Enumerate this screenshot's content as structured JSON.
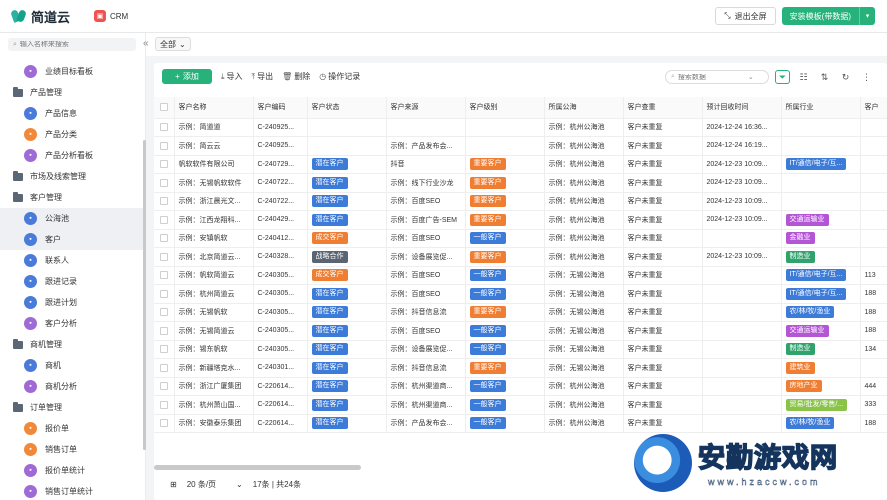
{
  "topbar": {
    "logo_text": "简道云",
    "app_icon_glyph": "▣",
    "app_name": "CRM",
    "exit_fullscreen": "退出全屏",
    "install_template": "安装模板(带数据)"
  },
  "sidebar": {
    "search_placeholder": "输入名称来搜索",
    "items": [
      {
        "label": "业绩目标看板",
        "kind": "child",
        "icon": "c-purple",
        "active": false
      },
      {
        "label": "产品管理",
        "kind": "group",
        "active": false
      },
      {
        "label": "产品信息",
        "kind": "child",
        "icon": "c-blue",
        "active": false
      },
      {
        "label": "产品分类",
        "kind": "child",
        "icon": "c-orange",
        "active": false
      },
      {
        "label": "产品分析看板",
        "kind": "child",
        "icon": "c-purple",
        "active": false
      },
      {
        "label": "市场及线索管理",
        "kind": "group",
        "active": false
      },
      {
        "label": "客户管理",
        "kind": "group",
        "active": false
      },
      {
        "label": "公海池",
        "kind": "child",
        "icon": "c-blue",
        "active": true
      },
      {
        "label": "客户",
        "kind": "child",
        "icon": "c-blue",
        "active": true
      },
      {
        "label": "联系人",
        "kind": "child",
        "icon": "c-blue",
        "active": false
      },
      {
        "label": "跟进记录",
        "kind": "child",
        "icon": "c-blue",
        "active": false
      },
      {
        "label": "跟进计划",
        "kind": "child",
        "icon": "c-blue",
        "active": false
      },
      {
        "label": "客户分析",
        "kind": "child",
        "icon": "c-purple",
        "active": false
      },
      {
        "label": "商机管理",
        "kind": "group",
        "active": false
      },
      {
        "label": "商机",
        "kind": "child",
        "icon": "c-blue",
        "active": false
      },
      {
        "label": "商机分析",
        "kind": "child",
        "icon": "c-purple",
        "active": false
      },
      {
        "label": "订单管理",
        "kind": "group",
        "active": false
      },
      {
        "label": "报价单",
        "kind": "child",
        "icon": "c-orange",
        "active": false
      },
      {
        "label": "销售订单",
        "kind": "child",
        "icon": "c-orange",
        "active": false
      },
      {
        "label": "报价单统计",
        "kind": "child",
        "icon": "c-purple",
        "active": false
      },
      {
        "label": "销售订单统计",
        "kind": "child",
        "icon": "c-purple",
        "active": false
      }
    ]
  },
  "filter": {
    "scope": "全部"
  },
  "toolbar": {
    "add": "添加",
    "import": "导入",
    "export": "导出",
    "delete": "删除",
    "log": "操作记录",
    "search_placeholder": "搜索数据"
  },
  "table": {
    "columns": [
      "客户名称",
      "客户编码",
      "客户状态",
      "客户来源",
      "客户级别",
      "所属公海",
      "客户查重",
      "预计回收时间",
      "所属行业",
      "客户"
    ],
    "rows": [
      {
        "name": "示例：简道道",
        "code": "C-240925...",
        "status": "",
        "source": "",
        "level": "",
        "pool": "示例：杭州公海池",
        "dup": "客户未重复",
        "time": "2024-12-24 16:36...",
        "industry": "",
        "ind_color": "",
        "extra": ""
      },
      {
        "name": "示例：简云云",
        "code": "C-240925...",
        "status": "",
        "source": "示例：产品发布会...",
        "level": "",
        "pool": "示例：杭州公海池",
        "dup": "客户未重复",
        "time": "2024-12-24 16:19...",
        "industry": "",
        "ind_color": "",
        "extra": ""
      },
      {
        "name": "帆软软件有限公司",
        "code": "C-240729...",
        "status": "潜在客户",
        "source": "抖音",
        "level": "重要客户",
        "pool": "示例：杭州公海池",
        "dup": "客户未重复",
        "time": "2024-12-23 10:09...",
        "industry": "IT/通信/电子/互...",
        "ind_color": "#3d7bd8",
        "extra": ""
      },
      {
        "name": "示例：无锡帆软软件",
        "code": "C-240722...",
        "status": "潜在客户",
        "source": "示例：线下行业沙龙",
        "level": "重要客户",
        "pool": "示例：杭州公海池",
        "dup": "客户未重复",
        "time": "2024-12-23 10:09...",
        "industry": "",
        "ind_color": "",
        "extra": ""
      },
      {
        "name": "示例：浙江晨光文...",
        "code": "C-240722...",
        "status": "潜在客户",
        "source": "示例：百度SEO",
        "level": "重要客户",
        "pool": "示例：杭州公海池",
        "dup": "客户未重复",
        "time": "2024-12-23 10:09...",
        "industry": "",
        "ind_color": "",
        "extra": ""
      },
      {
        "name": "示例：江西龙翔科...",
        "code": "C-240429...",
        "status": "潜在客户",
        "source": "示例：百度广告-SEM",
        "level": "重要客户",
        "pool": "示例：杭州公海池",
        "dup": "客户未重复",
        "time": "2024-12-23 10:09...",
        "industry": "交通运输业",
        "ind_color": "#b455d6",
        "extra": ""
      },
      {
        "name": "示例：安镇帆软",
        "code": "C-240412...",
        "status": "成交客户",
        "source": "示例：百度SEO",
        "level": "一般客户",
        "pool": "示例：杭州公海池",
        "dup": "客户未重复",
        "time": "",
        "industry": "金融业",
        "ind_color": "#b455d6",
        "extra": ""
      },
      {
        "name": "示例：北京简道云...",
        "code": "C-240328...",
        "status": "战略合作",
        "source": "示例：设备展览促...",
        "level": "重要客户",
        "pool": "示例：杭州公海池",
        "dup": "客户未重复",
        "time": "2024-12-23 10:09...",
        "industry": "制造业",
        "ind_color": "#2fa36b",
        "extra": ""
      },
      {
        "name": "示例：帆软简道云",
        "code": "C-240305...",
        "status": "成交客户",
        "source": "示例：百度SEO",
        "level": "一般客户",
        "pool": "示例：无锡公海池",
        "dup": "客户未重复",
        "time": "",
        "industry": "IT/通信/电子/互...",
        "ind_color": "#3d7bd8",
        "extra": "113"
      },
      {
        "name": "示例：杭州简道云",
        "code": "C-240305...",
        "status": "潜在客户",
        "source": "示例：百度SEO",
        "level": "一般客户",
        "pool": "示例：无锡公海池",
        "dup": "客户未重复",
        "time": "",
        "industry": "IT/通信/电子/互...",
        "ind_color": "#3d7bd8",
        "extra": "188"
      },
      {
        "name": "示例：无锡帆软",
        "code": "C-240305...",
        "status": "潜在客户",
        "source": "示例：抖音信息流",
        "level": "重要客户",
        "pool": "示例：无锡公海池",
        "dup": "客户未重复",
        "time": "",
        "industry": "农/林/牧/渔业",
        "ind_color": "#3d7bd8",
        "extra": "188"
      },
      {
        "name": "示例：无锡简道云",
        "code": "C-240305...",
        "status": "潜在客户",
        "source": "示例：百度SEO",
        "level": "一般客户",
        "pool": "示例：无锡公海池",
        "dup": "客户未重复",
        "time": "",
        "industry": "交通运输业",
        "ind_color": "#b455d6",
        "extra": "188"
      },
      {
        "name": "示例：锡东帆软",
        "code": "C-240305...",
        "status": "潜在客户",
        "source": "示例：设备展览促...",
        "level": "一般客户",
        "pool": "示例：无锡公海池",
        "dup": "客户未重复",
        "time": "",
        "industry": "制造业",
        "ind_color": "#2fa36b",
        "extra": "134"
      },
      {
        "name": "示例：新疆塔克水...",
        "code": "C-240301...",
        "status": "潜在客户",
        "source": "示例：抖音信息流",
        "level": "重要客户",
        "pool": "示例：无锡公海池",
        "dup": "客户未重复",
        "time": "",
        "industry": "建筑业",
        "ind_color": "#ef7d32",
        "extra": ""
      },
      {
        "name": "示例：浙江广厦集团",
        "code": "C-220614...",
        "status": "潜在客户",
        "source": "示例：杭州渠道商...",
        "level": "一般客户",
        "pool": "示例：杭州公海池",
        "dup": "客户未重复",
        "time": "",
        "industry": "房地产业",
        "ind_color": "#ef7d32",
        "extra": "444"
      },
      {
        "name": "示例：杭州萧山国...",
        "code": "C-220614...",
        "status": "潜在客户",
        "source": "示例：杭州渠道商...",
        "level": "一般客户",
        "pool": "示例：杭州公海池",
        "dup": "客户未重复",
        "time": "",
        "industry": "贸易/批发/零售/...",
        "ind_color": "#8bc34a",
        "extra": "333"
      },
      {
        "name": "示例：安徽泰乐集团",
        "code": "C-220614...",
        "status": "潜在客户",
        "source": "示例：产品发布会...",
        "level": "一般客户",
        "pool": "示例：杭州公海池",
        "dup": "客户未重复",
        "time": "",
        "industry": "农/林/牧/渔业",
        "ind_color": "#3d7bd8",
        "extra": "188"
      }
    ]
  },
  "pager": {
    "page_size": "20 条/页",
    "summary": "17条 | 共24条"
  },
  "watermark": {
    "text": "安勤游戏网",
    "url": "www.hzaccw.com"
  }
}
